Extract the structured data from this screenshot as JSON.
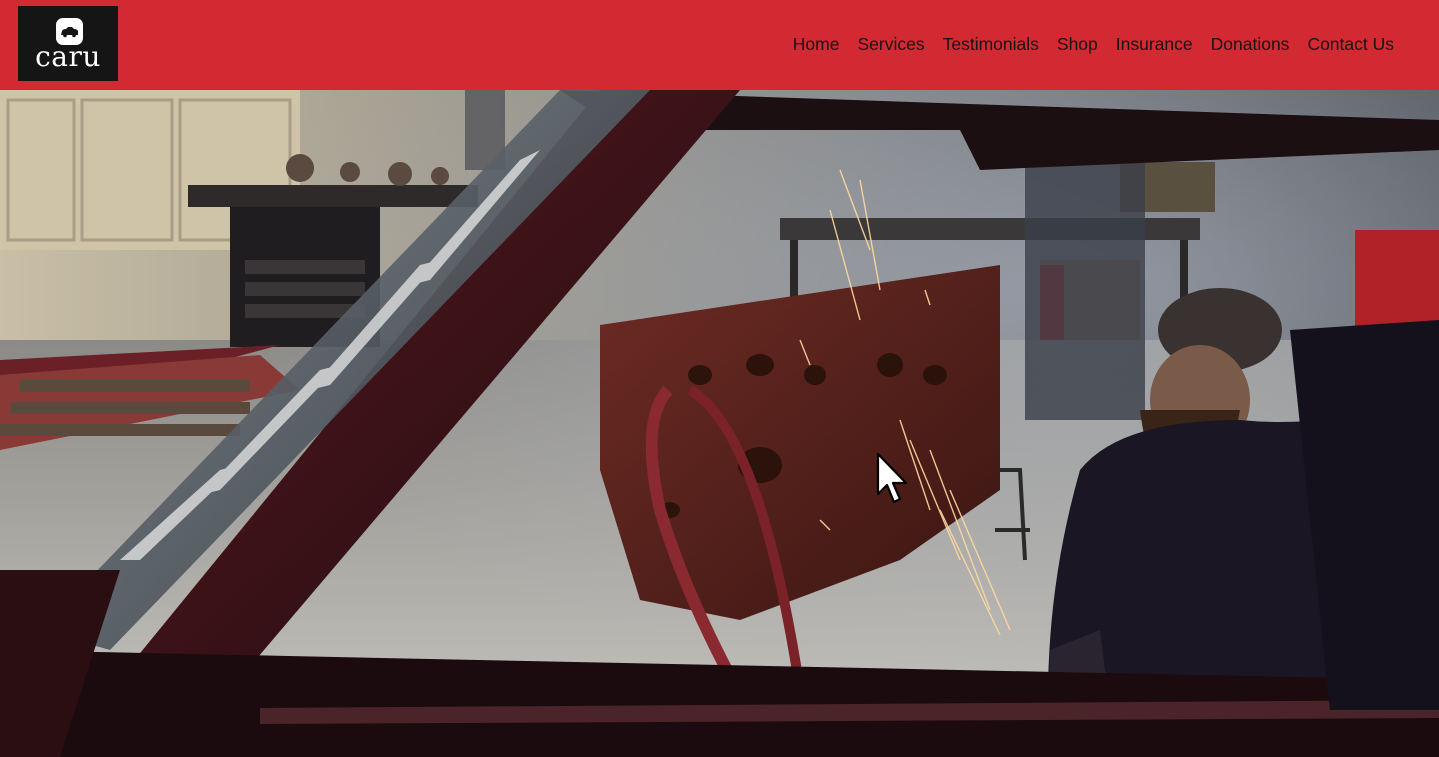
{
  "brand": {
    "logo_text": "caru",
    "logo_icon": "car-icon"
  },
  "nav": {
    "items": [
      {
        "label": "Home"
      },
      {
        "label": "Services"
      },
      {
        "label": "Testimonials"
      },
      {
        "label": "Shop"
      },
      {
        "label": "Insurance"
      },
      {
        "label": "Donations"
      },
      {
        "label": "Contact Us"
      }
    ]
  },
  "colors": {
    "header_bg": "#d32932",
    "logo_bg": "#151515",
    "nav_text": "#1a1214"
  },
  "hero": {
    "media": "welding-workshop-video"
  },
  "cursor": {
    "icon": "mouse-pointer-icon"
  }
}
